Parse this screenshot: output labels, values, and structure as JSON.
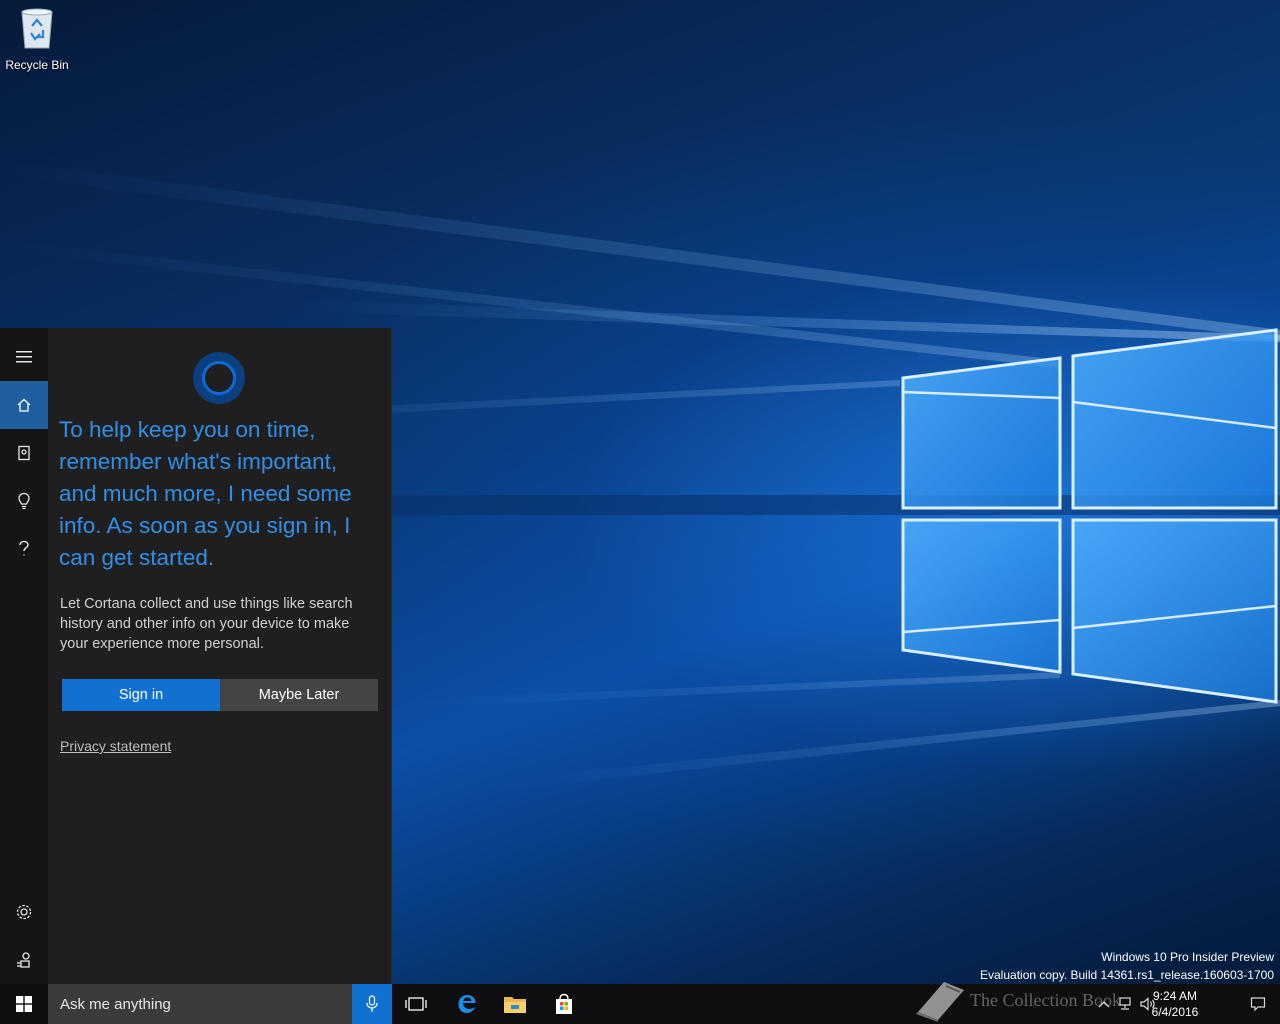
{
  "desktop": {
    "recycle_bin_label": "Recycle Bin",
    "watermark_line1": "Windows 10 Pro Insider Preview",
    "watermark_line2": "Evaluation copy. Build 14361.rs1_release.160603-1700"
  },
  "cortana": {
    "rail_icons": [
      "hamburger-menu-icon",
      "home-icon",
      "notebook-icon",
      "reminders-icon",
      "help-icon",
      "settings-icon",
      "feedback-icon"
    ],
    "headline": "To help keep you on time, remember what's important, and much more, I need some info. As soon as you sign in, I can get started.",
    "body": "Let Cortana collect and use things like search history and other info on your device to make your experience more personal.",
    "signin_label": "Sign in",
    "maybe_later_label": "Maybe Later",
    "privacy_label": "Privacy statement"
  },
  "taskbar": {
    "search_placeholder": "Ask me anything",
    "apps": [
      "task-view-icon",
      "edge-icon",
      "file-explorer-icon",
      "store-icon"
    ],
    "clock_time": "9:24 AM",
    "clock_date": "6/4/2016",
    "overlay_text": "The Collection Book"
  },
  "colors": {
    "accent": "#1171d1",
    "cortana_text": "#2f8fe8",
    "panel_bg": "#1f1f1f",
    "taskbar_bg": "#0e0e10"
  }
}
